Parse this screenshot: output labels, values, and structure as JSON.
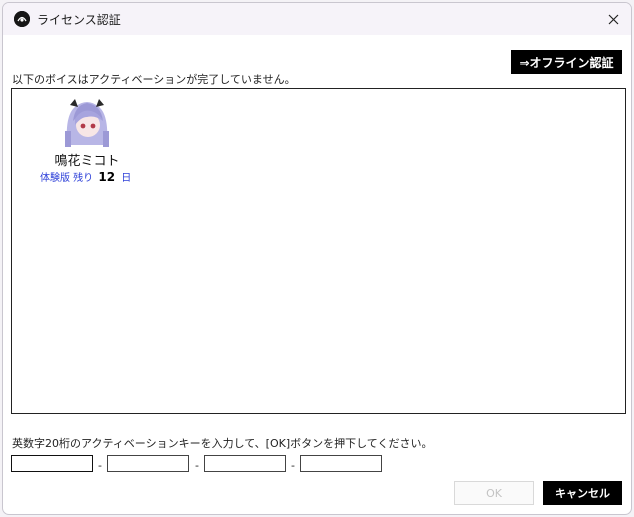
{
  "window": {
    "title": "ライセンス認証",
    "app_icon": "app-logo-icon",
    "close_icon": "close-icon"
  },
  "offline_button": {
    "label": "⇒オフライン認証"
  },
  "voice_list": {
    "header": "以下のボイスはアクティベーションが完了していません。",
    "items": [
      {
        "name": "鳴花ミコト",
        "trial_label": "体験版 残り",
        "days_remaining": "12",
        "days_unit": "日",
        "avatar_icon": "character-avatar"
      }
    ]
  },
  "activation": {
    "instruction": "英数字20桁のアクティベーションキーを入力して、[OK]ボタンを押下してください。",
    "fields": [
      {
        "value": ""
      },
      {
        "value": ""
      },
      {
        "value": ""
      },
      {
        "value": ""
      }
    ],
    "separator": "-"
  },
  "buttons": {
    "ok": "OK",
    "cancel": "キャンセル"
  },
  "colors": {
    "trial_text": "#2c3fd8",
    "button_bg": "#000000",
    "disabled_text": "#c3c3c3"
  }
}
